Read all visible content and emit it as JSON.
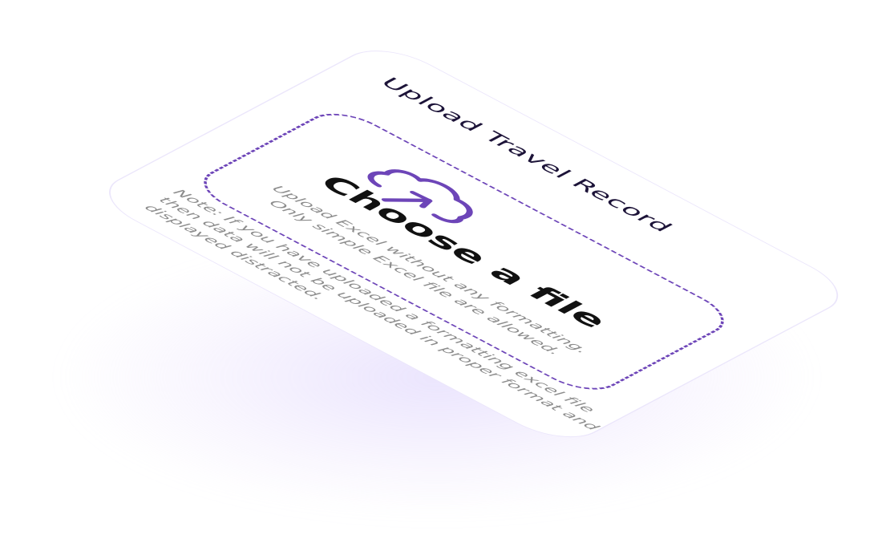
{
  "card": {
    "title": "Upload Travel Record",
    "dropzone": {
      "icon": "cloud-upload-icon",
      "heading": "Choose a file",
      "hint_line_1": "Upload Excel without any formatting.",
      "hint_line_2": "Only simple Excel file are allowed."
    },
    "note": {
      "line_1": "Note:  If you have uploaded a formatting excel file",
      "line_2": "then data will not be uploaded in proper format and",
      "line_3": "displayed distracted."
    }
  },
  "colors": {
    "accent": "#6d45b8",
    "title_text": "#1c1338",
    "muted_text": "#8c8c8c",
    "card_border": "#ebe6fb"
  }
}
